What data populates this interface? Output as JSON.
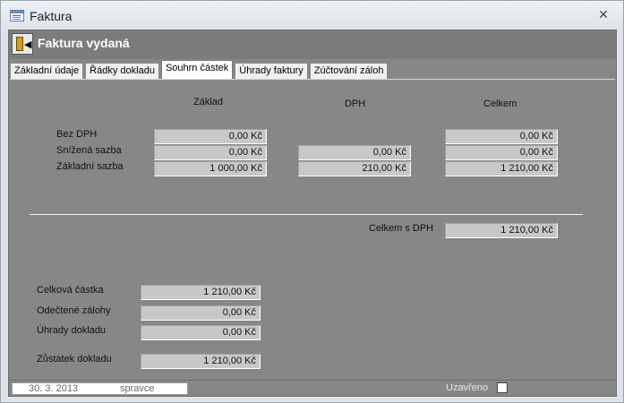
{
  "window": {
    "title": "Faktura",
    "close_glyph": "✕"
  },
  "form": {
    "title": "Faktura vydaná",
    "exit_icon": "exit-door-icon"
  },
  "tabs": [
    {
      "label": "Základní údaje",
      "active": false
    },
    {
      "label": "Řádky dokladu",
      "active": false
    },
    {
      "label": "Souhrn částek",
      "active": true
    },
    {
      "label": "Úhrady faktury",
      "active": false
    },
    {
      "label": "Zúčtování záloh",
      "active": false
    }
  ],
  "summary": {
    "col_base": "Základ",
    "col_vat": "DPH",
    "col_total": "Celkem",
    "rows": [
      {
        "label": "Bez  DPH",
        "base": "0,00 Kč",
        "vat": "",
        "total": "0,00 Kč"
      },
      {
        "label": "Snížená sazba",
        "base": "0,00 Kč",
        "vat": "0,00 Kč",
        "total": "0,00 Kč"
      },
      {
        "label": "Základní sazba",
        "base": "1 000,00 Kč",
        "vat": "210,00 Kč",
        "total": "1 210,00 Kč"
      }
    ],
    "total_with_vat_label": "Celkem s DPH",
    "total_with_vat": "1 210,00 Kč"
  },
  "balance": {
    "total_amount_label": "Celková částka",
    "total_amount": "1 210,00 Kč",
    "deducted_label": "Odečtené zálohy",
    "deducted": "0,00 Kč",
    "payments_label": "Úhrady dokladu",
    "payments": "0,00 Kč",
    "remaining_label": "Zůstatek dokladu",
    "remaining": "1 210,00 Kč"
  },
  "status": {
    "date": "30. 3. 2013",
    "user": "spravce",
    "closed_label": "Uzavřeno",
    "closed": false
  }
}
